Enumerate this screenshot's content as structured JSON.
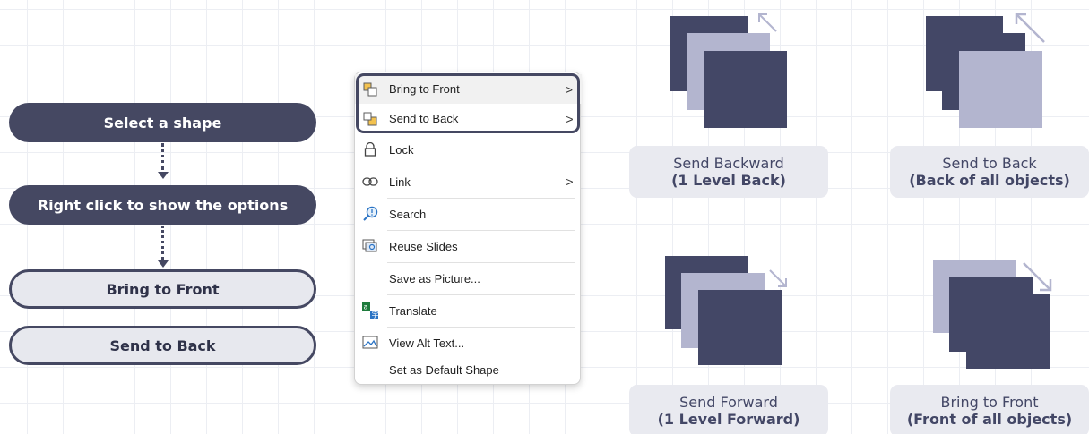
{
  "flow": {
    "step1": "Select a shape",
    "step2": "Right click to show the options",
    "option1": "Bring to Front",
    "option2": "Send to Back"
  },
  "menu": {
    "items": [
      {
        "label": "Bring to Front",
        "icon": "bring-to-front-icon",
        "submenu": true,
        "chevron": ">"
      },
      {
        "label": "Send to Back",
        "icon": "send-to-back-icon",
        "submenu": true,
        "chevron": ">"
      },
      {
        "label": "Lock",
        "icon": "lock-icon",
        "submenu": false
      },
      {
        "label": "Link",
        "icon": "link-icon",
        "submenu": true,
        "chevron": ">"
      },
      {
        "label": "Search",
        "icon": "search-icon",
        "submenu": false
      },
      {
        "label": "Reuse Slides",
        "icon": "reuse-slides-icon",
        "submenu": false
      },
      {
        "label": "Save as Picture...",
        "icon": "",
        "submenu": false
      },
      {
        "label": "Translate",
        "icon": "translate-icon",
        "submenu": false
      },
      {
        "label": "View Alt Text...",
        "icon": "alt-text-icon",
        "submenu": false
      },
      {
        "label": "Set as Default Shape",
        "icon": "",
        "submenu": false
      }
    ]
  },
  "illustrations": {
    "send_backward": {
      "title": "Send Backward",
      "subtitle": "(1 Level Back)"
    },
    "send_to_back": {
      "title": "Send to Back",
      "subtitle": "(Back of all objects)"
    },
    "send_forward": {
      "title": "Send Forward",
      "subtitle": "(1 Level Forward)"
    },
    "bring_to_front": {
      "title": "Bring to Front",
      "subtitle": "(Front of all objects)"
    }
  },
  "colors": {
    "dark": "#434766",
    "light": "#b3b5cf",
    "caption_bg": "#e9eaf0",
    "grid": "#eceef3"
  }
}
